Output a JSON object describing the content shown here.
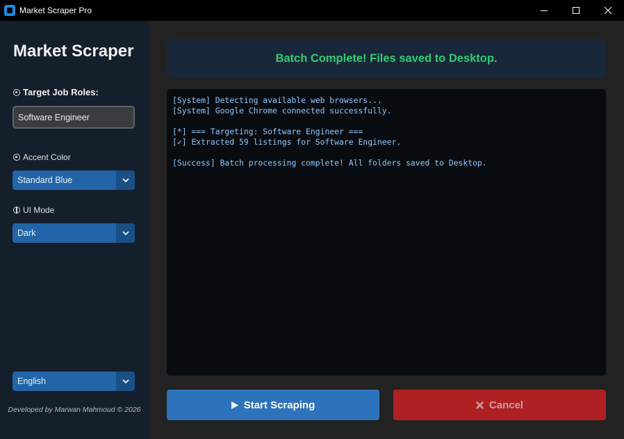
{
  "window": {
    "title": "Market Scraper Pro",
    "controls": [
      "minimize-icon",
      "maximize-icon",
      "close-icon"
    ]
  },
  "sidebar": {
    "app_title": "Market Scraper",
    "target_roles_label": "Target Job Roles:",
    "target_roles_value": "Software Engineer",
    "accent_label": "Accent Color",
    "accent_value": "Standard Blue",
    "ui_mode_label": "UI Mode",
    "ui_mode_value": "Dark",
    "language_value": "English",
    "footer": "Developed by Marwan Mahmoud © 2026"
  },
  "main": {
    "status": "Batch Complete! Files saved to Desktop.",
    "console_lines": [
      "[System] Detecting available web browsers...",
      "[System] Google Chrome connected successfully.",
      "",
      "[*] === Targeting: Software Engineer ===",
      "[✓] Extracted 59 listings for Software Engineer.",
      "",
      "[Success] Batch processing complete! All folders saved to Desktop."
    ],
    "start_button": "Start Scraping",
    "cancel_button": "Cancel"
  },
  "colors": {
    "accent": "#2164a8",
    "success": "#2ecc71",
    "danger": "#b01f22",
    "console_text": "#8fc8ff"
  }
}
